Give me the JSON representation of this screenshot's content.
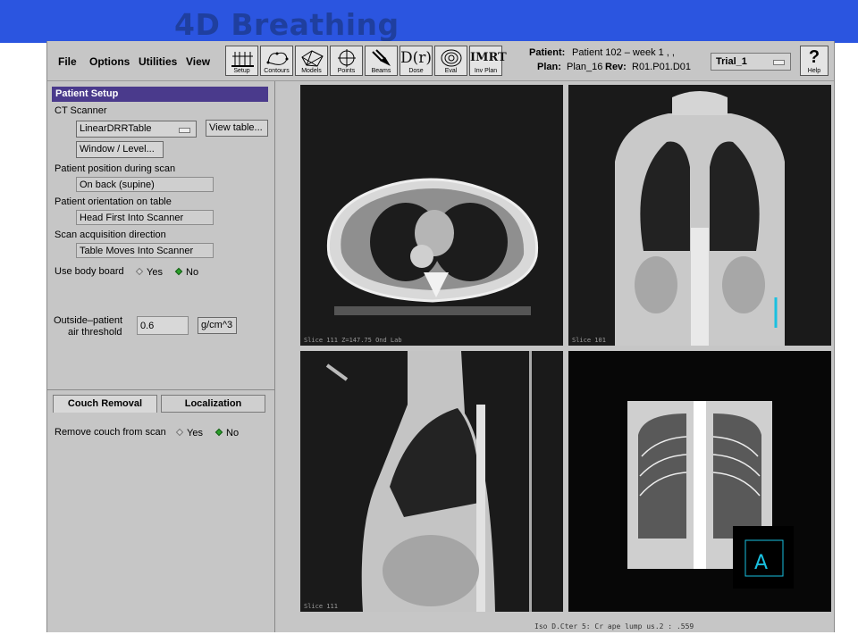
{
  "slide": {
    "title": "4D Breathing"
  },
  "menu": [
    "File",
    "Options",
    "Utilities",
    "View"
  ],
  "toolbar": {
    "tools": [
      {
        "label": "Setup",
        "icon": "setup-icon"
      },
      {
        "label": "Contours",
        "icon": "contours-icon"
      },
      {
        "label": "Models",
        "icon": "models-icon"
      },
      {
        "label": "Points",
        "icon": "points-icon"
      },
      {
        "label": "Beams",
        "icon": "beams-icon"
      },
      {
        "label": "Dose",
        "icon": "dose-icon",
        "glyph": "D(r)"
      },
      {
        "label": "Eval",
        "icon": "eval-icon"
      },
      {
        "label": "Inv Plan",
        "icon": "imrt-icon",
        "glyph": "IMRT"
      }
    ],
    "help_label": "Help",
    "help_glyph": "?"
  },
  "patient_info": {
    "patient_label": "Patient:",
    "patient_value": "Patient 102 – week 1 , ,",
    "plan_label": "Plan:",
    "plan_value": "Plan_16",
    "rev_label": "Rev:",
    "rev_value": "R01.P01.D01"
  },
  "trial": {
    "selected": "Trial_1"
  },
  "patient_setup": {
    "header": "Patient Setup",
    "ct_scanner_label": "CT Scanner",
    "ct_scanner_value": "LinearDRRTable",
    "view_table_button": "View table...",
    "window_level_button": "Window / Level...",
    "position_label": "Patient position during scan",
    "position_value": "On back (supine)",
    "orientation_label": "Patient orientation on table",
    "orientation_value": "Head First Into Scanner",
    "direction_label": "Scan acquisition direction",
    "direction_value": "Table Moves Into Scanner",
    "body_board_label": "Use body board",
    "yes": "Yes",
    "no": "No",
    "air_label_1": "Outside–patient",
    "air_label_2": "air threshold",
    "air_value": "0.6",
    "air_unit": "g/cm^3"
  },
  "tabs": [
    "Couch Removal",
    "Localization"
  ],
  "couch": {
    "label": "Remove couch from scan",
    "yes": "Yes",
    "no": "No"
  },
  "viewports": [
    {
      "name": "axial",
      "caption": "Slice 111 Z=147.75 Ond Lab"
    },
    {
      "name": "coronal",
      "caption": "Slice 101"
    },
    {
      "name": "sagittal",
      "caption": "Slice 111"
    },
    {
      "name": "drr",
      "caption": ""
    }
  ],
  "footer": "Iso D.Cter 5: Cr ape lump us.2 : .559",
  "colors": {
    "banner": "#2b55e0",
    "title": "#1f3f9f",
    "panel_header": "#4a3a8c",
    "radio_on": "#2aa02a"
  }
}
